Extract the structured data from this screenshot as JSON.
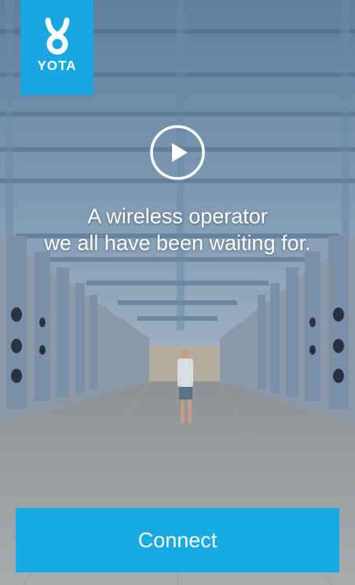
{
  "brand": {
    "name": "YOTA",
    "color": "#18a7e0",
    "logo_icon": "yota-logo-icon"
  },
  "video": {
    "play_icon": "play-icon"
  },
  "tagline": {
    "line1": "A wireless operator",
    "line2": "we all have been waiting for."
  },
  "actions": {
    "connect_label": "Connect",
    "connect_color": "#17aae3"
  }
}
